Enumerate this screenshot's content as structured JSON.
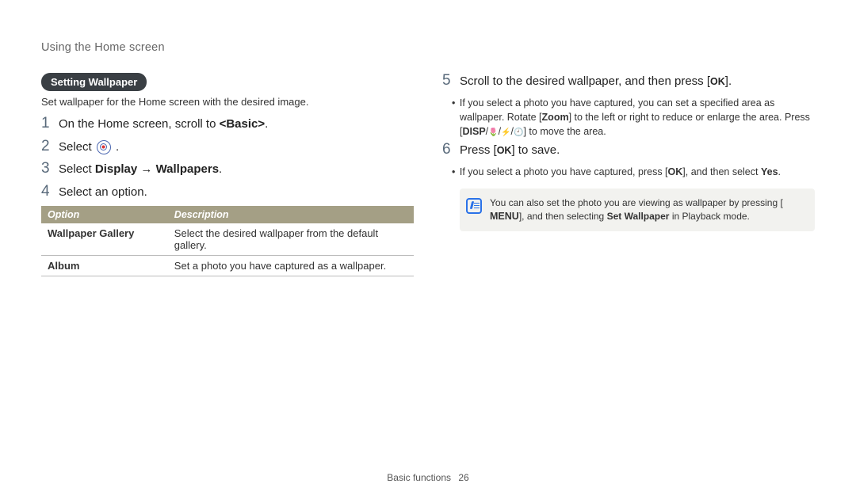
{
  "header": "Using the Home screen",
  "section_title": "Setting Wallpaper",
  "intro": "Set wallpaper for the Home screen with the desired image.",
  "steps_left": [
    {
      "num": "1",
      "parts": [
        "On the Home screen, scroll to ",
        {
          "b": "<Basic>"
        },
        "."
      ]
    },
    {
      "num": "2",
      "parts": [
        "Select ",
        {
          "icon": "target"
        },
        " ."
      ]
    },
    {
      "num": "3",
      "parts": [
        "Select ",
        {
          "b": "Display"
        },
        " → ",
        {
          "b": "Wallpapers"
        },
        "."
      ]
    },
    {
      "num": "4",
      "parts": [
        "Select an option."
      ]
    }
  ],
  "table": {
    "headers": [
      "Option",
      "Description"
    ],
    "rows": [
      [
        "Wallpaper Gallery",
        "Select the desired wallpaper from the default gallery."
      ],
      [
        "Album",
        "Set a photo you have captured as a wallpaper."
      ]
    ]
  },
  "steps_right": [
    {
      "num": "5",
      "parts": [
        "Scroll to the desired wallpaper, and then press [",
        {
          "btn": "OK"
        },
        "]."
      ],
      "sub": [
        [
          "If you select a photo you have captured, you can set a specified area as wallpaper. Rotate [",
          {
            "b": "Zoom"
          },
          "] to the left or right to reduce or enlarge the area. Press [",
          {
            "btn": "DISP"
          },
          "/",
          {
            "glyph": "🌷"
          },
          "/",
          {
            "glyph": "⚡"
          },
          "/",
          {
            "glyph": "🕘"
          },
          "] to move the area."
        ]
      ]
    },
    {
      "num": "6",
      "parts": [
        "Press [",
        {
          "btn": "OK"
        },
        "] to save."
      ],
      "sub": [
        [
          "If you select a photo you have captured, press [",
          {
            "btn": "OK"
          },
          "], and then select ",
          {
            "b": "Yes"
          },
          "."
        ]
      ]
    }
  ],
  "note": [
    "You can also set the photo you are viewing as wallpaper by pressing [",
    {
      "btn": "MENU"
    },
    "], and then selecting ",
    {
      "b": "Set Wallpaper"
    },
    " in Playback mode."
  ],
  "footer": {
    "section": "Basic functions",
    "page": "26"
  }
}
